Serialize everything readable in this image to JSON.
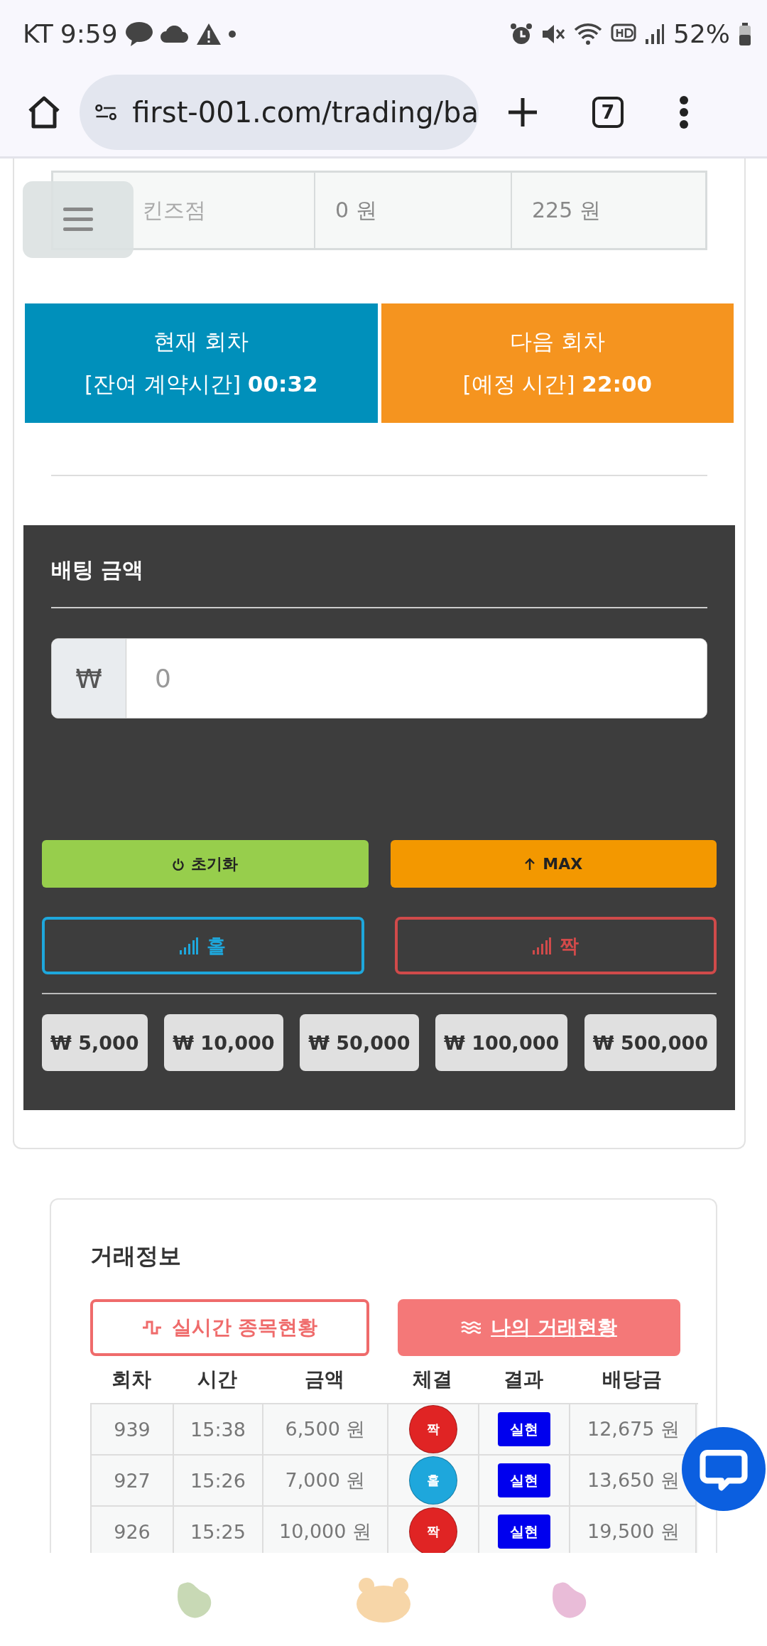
{
  "status_bar": {
    "carrier": "KT",
    "time": "9:59",
    "battery": "52%"
  },
  "browser": {
    "url": "first-001.com/trading/ba",
    "tab_count": "7"
  },
  "summary_row": [
    "킨즈점",
    "0 원",
    "225 원"
  ],
  "rounds": [
    {
      "title": "현재 회차",
      "label": "[잔여 계약시간]",
      "time": "00:32",
      "color": "#0090bb"
    },
    {
      "title": "다음 회차",
      "label": "[예정 시간]",
      "time": "22:00",
      "color": "#f5941f"
    }
  ],
  "bet": {
    "title": "배팅 금액",
    "currency": "₩",
    "placeholder": "0",
    "actions": [
      {
        "kind": "reset",
        "label": "초기화",
        "color": "#97ce4c"
      },
      {
        "kind": "max",
        "label": "MAX",
        "color": "#f39800"
      }
    ],
    "picks": [
      {
        "label": "홀",
        "color": "#1ea7dc"
      },
      {
        "label": "짝",
        "color": "#d04a4a"
      }
    ],
    "chips": [
      "₩ 5,000",
      "₩ 10,000",
      "₩ 50,000",
      "₩ 100,000",
      "₩ 500,000"
    ]
  },
  "trade_info": {
    "title": "거래정보",
    "tabs": [
      {
        "kind": "live",
        "label": "실시간 종목현황",
        "selected": false
      },
      {
        "kind": "mine",
        "label": "나의 거래현황",
        "selected": true
      }
    ],
    "columns": [
      "회차",
      "시간",
      "금액",
      "체결",
      "결과",
      "배당금"
    ],
    "rows": [
      {
        "round": "939",
        "time": "15:38",
        "amount": "6,500 원",
        "pick": {
          "label": "짝",
          "color": "#e02424"
        },
        "result": "실현",
        "payout": "12,675 원"
      },
      {
        "round": "927",
        "time": "15:26",
        "amount": "7,000 원",
        "pick": {
          "label": "홀",
          "color": "#1ea7dc"
        },
        "result": "실현",
        "payout": "13,650 원"
      },
      {
        "round": "926",
        "time": "15:25",
        "amount": "10,000 원",
        "pick": {
          "label": "짝",
          "color": "#e02424"
        },
        "result": "실현",
        "payout": "19,500 원"
      }
    ]
  }
}
